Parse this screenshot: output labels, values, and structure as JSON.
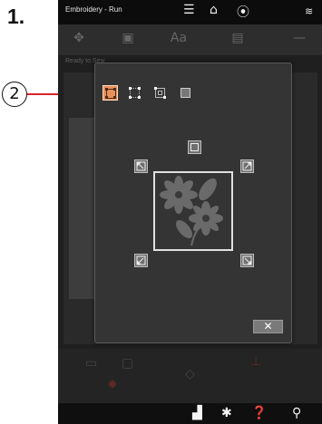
{
  "figure": {
    "step_label": "1.",
    "callout_number": "2",
    "callout_line_color": "#d8232a"
  },
  "statusbar": {
    "title": "Embroidery - Run",
    "icons": [
      "menu-icon",
      "home-icon",
      "machine-icon",
      "wifi-icon"
    ]
  },
  "toolbar": {
    "text_tab": "Aa"
  },
  "subheader": {
    "status_text": "Ready to Sew"
  },
  "dialog": {
    "trace_options": [
      {
        "name": "trace-corners-outline",
        "selected": true
      },
      {
        "name": "trace-corner-points",
        "selected": false
      },
      {
        "name": "trace-inner-outline",
        "selected": false
      },
      {
        "name": "trace-filled-outline",
        "selected": false
      }
    ],
    "center_button_icon": "center-frame-icon",
    "corner_buttons": [
      "arrow-top-left-icon",
      "arrow-top-right-icon",
      "arrow-bottom-left-icon",
      "arrow-bottom-right-icon"
    ],
    "close_label": "✕",
    "accent_color": "#e8905c"
  },
  "navbar": {
    "icons": [
      "embroidery-unit-icon",
      "settings-icon",
      "help-icon",
      "tool-icon"
    ]
  }
}
